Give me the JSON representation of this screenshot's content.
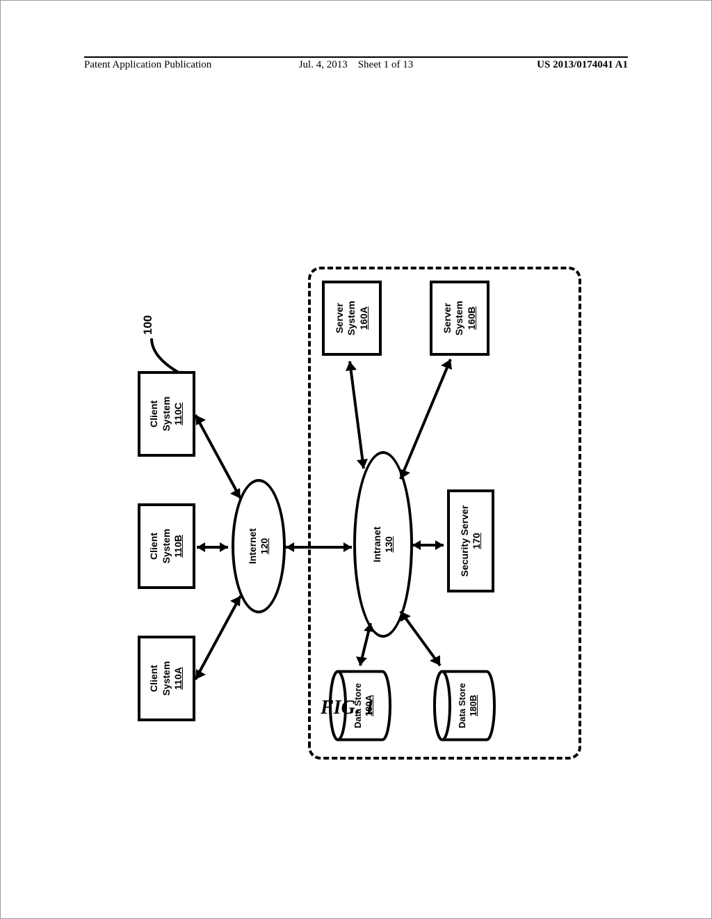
{
  "header": {
    "left": "Patent Application Publication",
    "center_date": "Jul. 4, 2013",
    "center_sheet": "Sheet 1 of 13",
    "right": "US 2013/0174041 A1"
  },
  "figure_label": "FIG. 1",
  "diagram_number": "100",
  "nodes": {
    "client_a": {
      "title": "Client",
      "sub": "System",
      "ref": "110A"
    },
    "client_b": {
      "title": "Client",
      "sub": "System",
      "ref": "110B"
    },
    "client_c": {
      "title": "Client",
      "sub": "System",
      "ref": "110C"
    },
    "internet": {
      "title": "Internet",
      "ref": "120"
    },
    "intranet": {
      "title": "Intranet",
      "ref": "130"
    },
    "server_a": {
      "title": "Server",
      "sub": "System",
      "ref": "160A"
    },
    "server_b": {
      "title": "Server",
      "sub": "System",
      "ref": "160B"
    },
    "security": {
      "title": "Security Server",
      "ref": "170"
    },
    "ds_a": {
      "title": "Data Store",
      "ref": "180A"
    },
    "ds_b": {
      "title": "Data Store",
      "ref": "180B"
    }
  }
}
